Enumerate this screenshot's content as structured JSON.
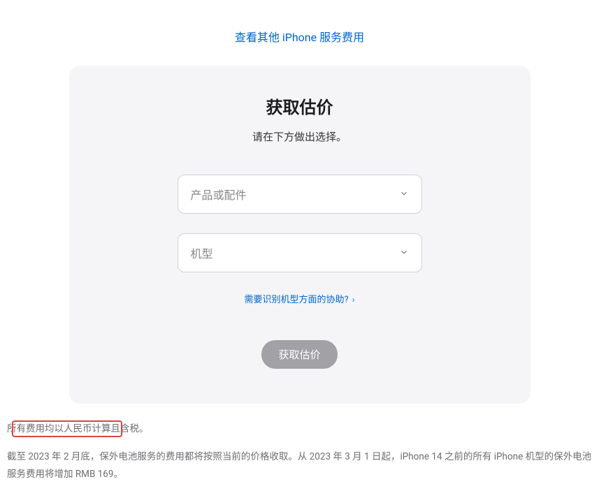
{
  "topLink": {
    "label": "查看其他 iPhone 服务费用"
  },
  "card": {
    "title": "获取估价",
    "subtitle": "请在下方做出选择。",
    "select1": {
      "placeholder": "产品或配件"
    },
    "select2": {
      "placeholder": "机型"
    },
    "helpLink": {
      "label": "需要识别机型方面的协助?"
    },
    "submit": {
      "label": "获取估价"
    }
  },
  "footer": {
    "line1": "所有费用均以人民币计算且含税。",
    "line2": "截至 2023 年 2 月底，保外电池服务的费用都将按照当前的价格收取。从 2023 年 3 月 1 日起，iPhone 14 之前的所有 iPhone 机型的保外电池服务费用将增加 RMB 169。"
  }
}
